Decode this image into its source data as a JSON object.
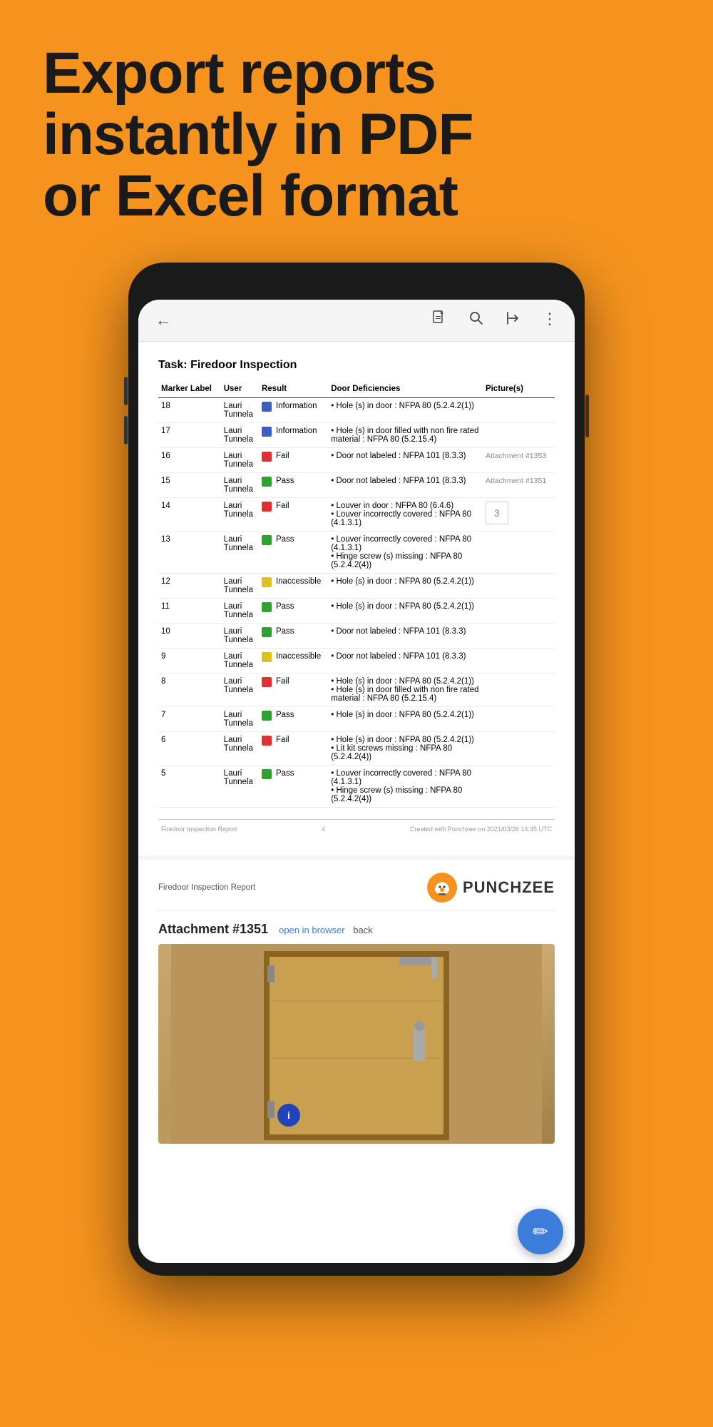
{
  "hero": {
    "line1": "Export reports",
    "line2": "instantly in PDF",
    "line3": "or Excel format"
  },
  "browser": {
    "back_icon": "←",
    "pdf_icon": "⊞",
    "search_icon": "🔍",
    "share_icon": "↗",
    "more_icon": "⋮"
  },
  "pdf_page": {
    "task_label": "Task:",
    "task_name": "Firedoor Inspection",
    "columns": [
      "Marker Label",
      "User",
      "Result",
      "Door Deficiencies",
      "Picture(s)"
    ],
    "rows": [
      {
        "marker": "18",
        "user": "Lauri\nTunnela",
        "result_color": "blue",
        "result_text": "Information",
        "deficiencies": "• Hole (s) in door : NFPA 80 (5.2.4.2(1))",
        "picture": ""
      },
      {
        "marker": "17",
        "user": "Lauri\nTunnela",
        "result_color": "blue",
        "result_text": "Information",
        "deficiencies": "• Hole (s) in door filled with non fire rated material : NFPA 80 (5.2.15.4)",
        "picture": ""
      },
      {
        "marker": "16",
        "user": "Lauri\nTunnela",
        "result_color": "red",
        "result_text": "Fail",
        "deficiencies": "• Door not labeled : NFPA 101 (8.3.3)",
        "picture": "Attachment #1353"
      },
      {
        "marker": "15",
        "user": "Lauri\nTunnela",
        "result_color": "green",
        "result_text": "Pass",
        "deficiencies": "• Door not labeled : NFPA 101 (8.3.3)",
        "picture": "Attachment #1351"
      },
      {
        "marker": "14",
        "user": "Lauri\nTunnela",
        "result_color": "red",
        "result_text": "Fail",
        "deficiencies": "• Louver in door : NFPA 80 (6.4.6)\n• Louver incorrectly covered : NFPA 80 (4.1.3.1)",
        "picture": "3"
      },
      {
        "marker": "13",
        "user": "Lauri\nTunnela",
        "result_color": "green",
        "result_text": "Pass",
        "deficiencies": "• Louver incorrectly covered : NFPA 80 (4.1.3.1)\n• Hinge screw (s) missing : NFPA 80 (5.2.4.2(4))",
        "picture": ""
      },
      {
        "marker": "12",
        "user": "Lauri\nTunnela",
        "result_color": "yellow",
        "result_text": "Inaccessible",
        "deficiencies": "• Hole (s) in door : NFPA 80 (5.2.4.2(1))",
        "picture": ""
      },
      {
        "marker": "11",
        "user": "Lauri\nTunnela",
        "result_color": "green",
        "result_text": "Pass",
        "deficiencies": "• Hole (s) in door : NFPA 80 (5.2.4.2(1))",
        "picture": ""
      },
      {
        "marker": "10",
        "user": "Lauri\nTunnela",
        "result_color": "green",
        "result_text": "Pass",
        "deficiencies": "• Door not labeled : NFPA 101 (8.3.3)",
        "picture": ""
      },
      {
        "marker": "9",
        "user": "Lauri\nTunnela",
        "result_color": "yellow",
        "result_text": "Inaccessible",
        "deficiencies": "• Door not labeled : NFPA 101 (8.3.3)",
        "picture": ""
      },
      {
        "marker": "8",
        "user": "Lauri\nTunnela",
        "result_color": "red",
        "result_text": "Fail",
        "deficiencies": "• Hole (s) in door : NFPA 80 (5.2.4.2(1))\n• Hole (s) in door filled with non fire rated material : NFPA 80 (5.2.15.4)",
        "picture": ""
      },
      {
        "marker": "7",
        "user": "Lauri\nTunnela",
        "result_color": "green",
        "result_text": "Pass",
        "deficiencies": "• Hole (s) in door : NFPA 80 (5.2.4.2(1))",
        "picture": ""
      },
      {
        "marker": "6",
        "user": "Lauri\nTunnela",
        "result_color": "red",
        "result_text": "Fail",
        "deficiencies": "• Hole (s) in door : NFPA 80 (5.2.4.2(1))\n• Lit kit screws missing : NFPA 80 (5.2.4.2(4))",
        "picture": ""
      },
      {
        "marker": "5",
        "user": "Lauri\nTunnela",
        "result_color": "green",
        "result_text": "Pass",
        "deficiencies": "• Louver incorrectly covered : NFPA 80 (4.1.3.1)\n• Hinge screw (s) missing : NFPA 80 (5.2.4.2(4))",
        "picture": ""
      }
    ],
    "footer_left": "Firedoor Inspection Report",
    "footer_center": "4",
    "footer_right": "Created with Punchzee on 2021/03/26 14:35 UTC"
  },
  "pdf_page2": {
    "header_title": "Firedoor Inspection Report",
    "logo_name": "PUNCHZEE",
    "attachment_title": "Attachment #1351",
    "open_browser_link": "open in browser",
    "back_link": "back"
  },
  "fab": {
    "icon": "✏"
  }
}
